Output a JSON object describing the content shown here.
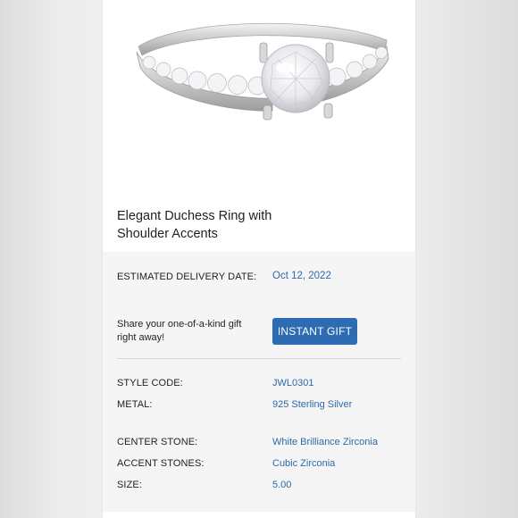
{
  "product": {
    "title_line1": "Elegant Duchess Ring with",
    "title_line2": "Shoulder Accents"
  },
  "delivery": {
    "label": "ESTIMATED DELIVERY DATE:",
    "value": "Oct 12, 2022"
  },
  "gift": {
    "text_line1": "Share your one-of-a-kind gift",
    "text_line2": "right away!",
    "button_label": "INSTANT GIFT"
  },
  "specs": [
    {
      "label": "STYLE CODE:",
      "value": "JWL0301"
    },
    {
      "label": "METAL:",
      "value": "925 Sterling Silver"
    },
    {
      "label": "CENTER STONE:",
      "value": "White Brilliance Zirconia"
    },
    {
      "label": "ACCENT STONES:",
      "value": "Cubic Zirconia"
    },
    {
      "label": "SIZE:",
      "value": "5.00"
    }
  ],
  "colors": {
    "accent": "#2d6bb2",
    "value_text": "#2b6aa6",
    "background": "#f5f5f5"
  }
}
